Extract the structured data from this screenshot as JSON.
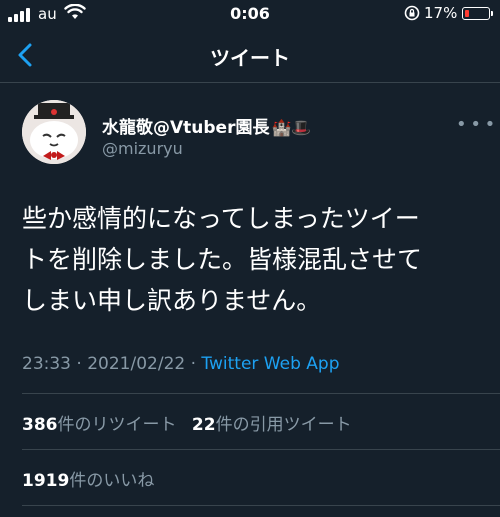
{
  "status_bar": {
    "carrier": "au",
    "time": "0:06",
    "battery_percent": "17%",
    "battery_level": 0.17,
    "signal_icon": "signal-bars-icon",
    "wifi_icon": "wifi-icon",
    "orientation_lock_icon": "orientation-lock-icon"
  },
  "nav": {
    "title": "ツイート",
    "back_icon": "chevron-left-icon"
  },
  "tweet": {
    "display_name": "水龍敬@Vtuber園長",
    "name_emoji": "🏰🎩",
    "handle": "@mizuryu",
    "lines": [
      "些か感情的になってしまったツイー",
      "トを削除しました。皆様混乱させて",
      "しまい申し訳ありません。"
    ],
    "time": "23:33",
    "date": "2021/02/22",
    "separator": "·",
    "source": "Twitter Web App",
    "more_icon": "more-horizontal-icon"
  },
  "stats": {
    "retweets": "386",
    "retweets_label": "件のリツイート",
    "quotes": "22",
    "quotes_label": "件の引用ツイート",
    "likes": "1919",
    "likes_label": "件のいいね"
  },
  "colors": {
    "background": "#15202b",
    "accent": "#1da1f2",
    "secondary_text": "#8899a6",
    "divider": "#38444d"
  }
}
